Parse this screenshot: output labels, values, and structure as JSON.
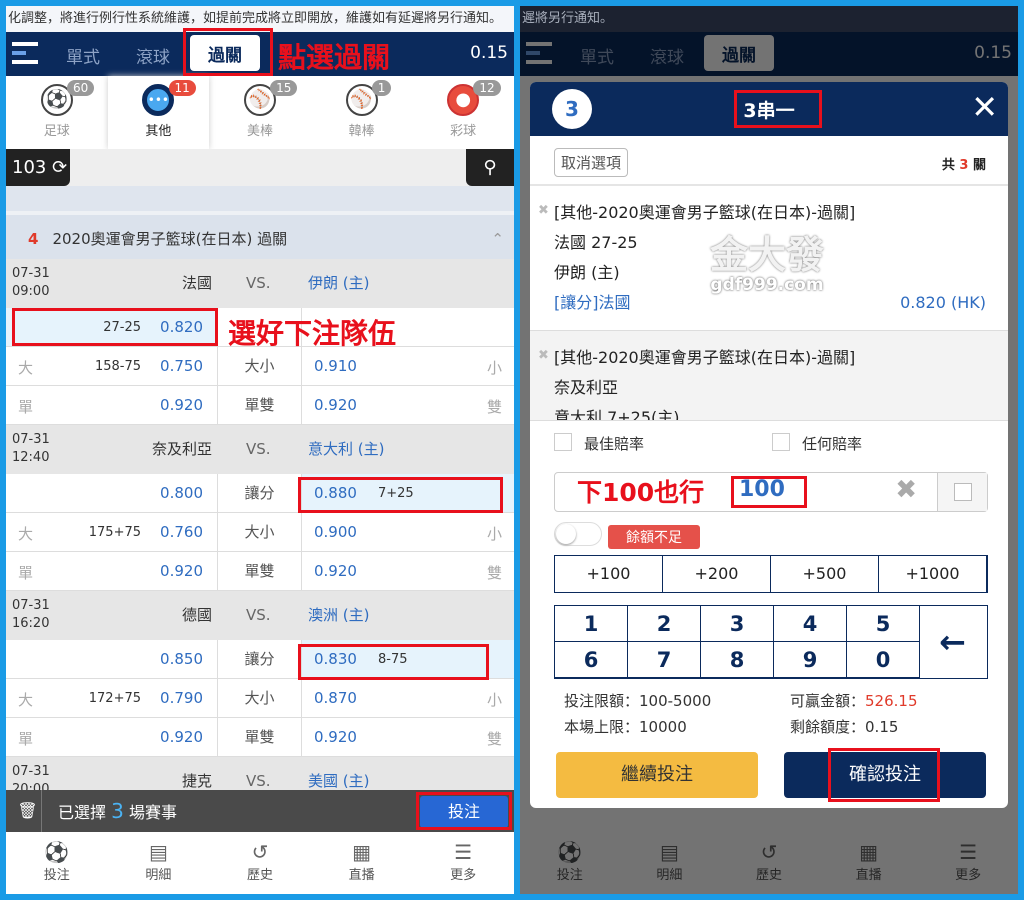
{
  "notice": {
    "left": "化調整，將進行例行性系統維護，如提前完成將立即開放，維護如有延遲將另行通知。",
    "right": "遲將另行通知。"
  },
  "nav": {
    "tabs": [
      "單式",
      "滾球",
      "過關"
    ],
    "active": "過關",
    "balance": "0.15"
  },
  "annotations": {
    "click_parlay": "點選過關",
    "choose_team": "選好下注隊伍",
    "stake_note": "下100也行"
  },
  "sports": [
    {
      "label": "足球",
      "count": "60",
      "icon": "soccer-ball-icon"
    },
    {
      "label": "其他",
      "count": "11",
      "icon": "more-dots-icon"
    },
    {
      "label": "美棒",
      "count": "15",
      "icon": "baseball-icon"
    },
    {
      "label": "韓棒",
      "count": "1",
      "icon": "baseball-icon"
    },
    {
      "label": "彩球",
      "count": "12",
      "icon": "lottery-ball-icon"
    }
  ],
  "search": {
    "count": "103"
  },
  "league": {
    "index": "4",
    "name": "2020奧運會男子籃球(在日本) 過關"
  },
  "matches": [
    {
      "date": "07-31",
      "time": "09:00",
      "home": "法國",
      "vs": "VS.",
      "away": "伊朗 (主)",
      "rows": [
        {
          "l_label": "",
          "l_line": "27-25",
          "l_odd": "0.820",
          "mid": "",
          "r_odd": "",
          "r_line": "",
          "r_label": "",
          "hl": "left"
        },
        {
          "l_label": "大",
          "l_line": "158-75",
          "l_odd": "0.750",
          "mid": "大小",
          "r_odd": "0.910",
          "r_line": "",
          "r_label": "小"
        },
        {
          "l_label": "單",
          "l_line": "",
          "l_odd": "0.920",
          "mid": "單雙",
          "r_odd": "0.920",
          "r_line": "",
          "r_label": "雙"
        }
      ]
    },
    {
      "date": "07-31",
      "time": "12:40",
      "home": "奈及利亞",
      "vs": "VS.",
      "away": "意大利 (主)",
      "rows": [
        {
          "l_label": "",
          "l_line": "",
          "l_odd": "0.800",
          "mid": "讓分",
          "r_odd": "0.880",
          "r_line": "7+25",
          "r_label": "",
          "hl": "right"
        },
        {
          "l_label": "大",
          "l_line": "175+75",
          "l_odd": "0.760",
          "mid": "大小",
          "r_odd": "0.900",
          "r_line": "",
          "r_label": "小"
        },
        {
          "l_label": "單",
          "l_line": "",
          "l_odd": "0.920",
          "mid": "單雙",
          "r_odd": "0.920",
          "r_line": "",
          "r_label": "雙"
        }
      ]
    },
    {
      "date": "07-31",
      "time": "16:20",
      "home": "德國",
      "vs": "VS.",
      "away": "澳洲 (主)",
      "rows": [
        {
          "l_label": "",
          "l_line": "",
          "l_odd": "0.850",
          "mid": "讓分",
          "r_odd": "0.830",
          "r_line": "8-75",
          "r_label": "",
          "hl": "right"
        },
        {
          "l_label": "大",
          "l_line": "172+75",
          "l_odd": "0.790",
          "mid": "大小",
          "r_odd": "0.870",
          "r_line": "",
          "r_label": "小"
        },
        {
          "l_label": "單",
          "l_line": "",
          "l_odd": "0.920",
          "mid": "單雙",
          "r_odd": "0.920",
          "r_line": "",
          "r_label": "雙"
        }
      ]
    },
    {
      "date": "07-31",
      "time": "20:00",
      "home": "捷克",
      "vs": "VS.",
      "away": "美國 (主)",
      "rows": []
    }
  ],
  "selection": {
    "prefix": "已選擇",
    "count": "3",
    "suffix": "場賽事",
    "bet_button": "投注"
  },
  "bottom_nav": [
    {
      "label": "投注",
      "icon": "soccer-ball-icon"
    },
    {
      "label": "明細",
      "icon": "document-icon"
    },
    {
      "label": "歷史",
      "icon": "history-icon"
    },
    {
      "label": "直播",
      "icon": "film-icon"
    },
    {
      "label": "更多",
      "icon": "menu-icon"
    }
  ],
  "modal": {
    "count": "3",
    "title": "3串一",
    "cancel": "取消選項",
    "total_prefix": "共",
    "total_count": "3",
    "total_suffix": "關",
    "slips": [
      {
        "league": "[其他-2020奧運會男子籃球(在日本)-過關]",
        "line1": "法國 27-25",
        "line2": "伊朗 (主)",
        "pick": "[讓分]法國",
        "odds": "0.820 (HK)"
      },
      {
        "league": "[其他-2020奧運會男子籃球(在日本)-過關]",
        "line1": "奈及利亞",
        "line2": "意大利 7+25(主)"
      }
    ],
    "watermark": {
      "big": "金大發",
      "small": "gdf999.com"
    },
    "best_odds": "最佳賠率",
    "any_odds": "任何賠率",
    "amount": "100",
    "warning": "餘額不足",
    "chips": [
      "+100",
      "+200",
      "+500",
      "+1000"
    ],
    "keys": [
      "1",
      "2",
      "3",
      "4",
      "5",
      "6",
      "7",
      "8",
      "9",
      "0"
    ],
    "limit_label": "投注限額：",
    "limit": "100-5000",
    "win_label": "可贏金額：",
    "win": "526.15",
    "max_label": "本場上限：",
    "max": "10000",
    "remain_label": "剩餘額度：",
    "remain": "0.15",
    "continue": "繼續投注",
    "confirm": "確認投注"
  }
}
